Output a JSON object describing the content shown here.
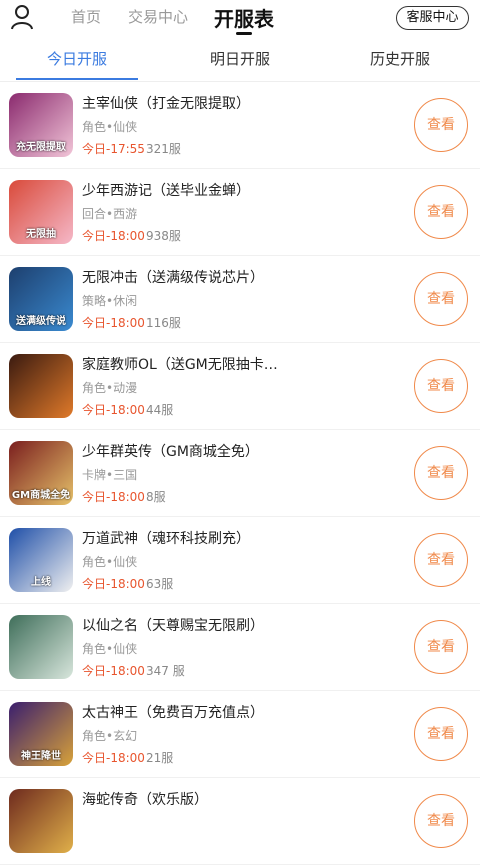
{
  "header": {
    "user_icon": "user-icon",
    "nav_home": "首页",
    "nav_trade": "交易中心",
    "nav_active": "开服表",
    "service_label": "客服中心"
  },
  "tabs": [
    {
      "label": "今日开服",
      "active": true
    },
    {
      "label": "明日开服",
      "active": false
    },
    {
      "label": "历史开服",
      "active": false
    }
  ],
  "view_label": "查看",
  "games": [
    {
      "name": "主宰仙侠（打金无限提取）",
      "category": "角色•仙侠",
      "time": "今日-17:55",
      "servers": "321服",
      "thumb_text": "充无限提取",
      "colors": [
        "#8a2a6e",
        "#f2c6d8"
      ]
    },
    {
      "name": "少年西游记（送毕业金蝉）",
      "category": "回合•西游",
      "time": "今日-18:00",
      "servers": "938服",
      "thumb_text": "无限抽",
      "colors": [
        "#d94a3a",
        "#f5b8c8"
      ]
    },
    {
      "name": "无限冲击（送满级传说芯片）",
      "category": "策略•休闲",
      "time": "今日-18:00",
      "servers": "116服",
      "thumb_text": "送满级传说",
      "colors": [
        "#1d3f6e",
        "#3a8ad0"
      ]
    },
    {
      "name": "家庭教师OL（送GM无限抽卡…",
      "category": "角色•动漫",
      "time": "今日-18:00",
      "servers": "44服",
      "thumb_text": "",
      "colors": [
        "#3a1a10",
        "#e07a2a"
      ]
    },
    {
      "name": "少年群英传（GM商城全免）",
      "category": "卡牌•三国",
      "time": "今日-18:00",
      "servers": "8服",
      "thumb_text": "GM商城全免",
      "colors": [
        "#7a1e1e",
        "#e6c26a"
      ]
    },
    {
      "name": "万道武神（魂环科技刷充）",
      "category": "角色•仙侠",
      "time": "今日-18:00",
      "servers": "63服",
      "thumb_text": "上线",
      "colors": [
        "#1f4fa8",
        "#f0f0f0"
      ]
    },
    {
      "name": "以仙之名（天尊赐宝无限刷）",
      "category": "角色•仙侠",
      "time": "今日-18:00",
      "servers": "347 服",
      "thumb_text": "",
      "colors": [
        "#3f6e5a",
        "#d8e6dc"
      ]
    },
    {
      "name": "太古神王（免费百万充值点）",
      "category": "角色•玄幻",
      "time": "今日-18:00",
      "servers": "21服",
      "thumb_text": "神王降世",
      "colors": [
        "#3a1e6e",
        "#d8a23a"
      ]
    },
    {
      "name": "海蛇传奇（欢乐版）",
      "category": "",
      "time": "",
      "servers": "",
      "thumb_text": "",
      "colors": [
        "#6e2a1e",
        "#e0b04a"
      ]
    }
  ]
}
